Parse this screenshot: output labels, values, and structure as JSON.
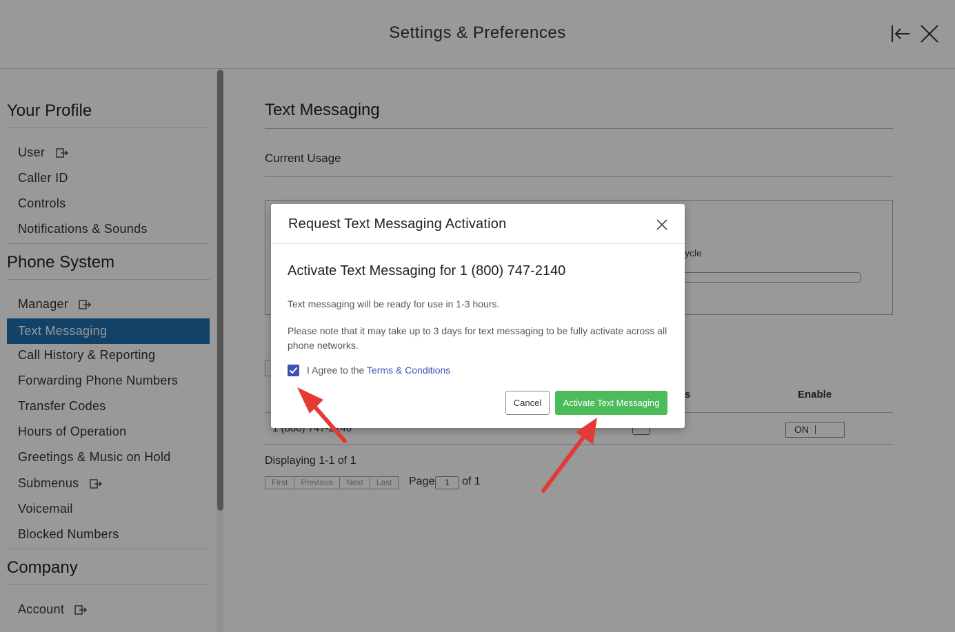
{
  "header": {
    "title": "Settings & Preferences"
  },
  "sidebar": {
    "sections": [
      {
        "title": "Your Profile"
      },
      {
        "title": "Phone System"
      },
      {
        "title": "Company"
      }
    ],
    "profile_items": [
      "User",
      "Caller ID",
      "Controls",
      "Notifications & Sounds"
    ],
    "phone_items": [
      "Manager",
      "Text Messaging",
      "Call History & Reporting",
      "Forwarding Phone Numbers",
      "Transfer Codes",
      "Hours of Operation",
      "Greetings & Music on Hold",
      "Submenus",
      "Voicemail",
      "Blocked Numbers"
    ],
    "company_items": [
      "Account"
    ],
    "active_item": "Text Messaging"
  },
  "main": {
    "title": "Text Messaging",
    "usage_label": "Current Usage",
    "cycle_partial": "ycle",
    "col_partial": "s",
    "col_enable": "Enable",
    "row_number": "1 (800) 747-2140",
    "toggle_label": "ON",
    "displaying": "Displaying 1-1 of 1",
    "pager": {
      "first": "First",
      "previous": "Previous",
      "next": "Next",
      "last": "Last"
    },
    "page_label": "Page",
    "page_value": "1",
    "page_of": "of 1"
  },
  "modal": {
    "title": "Request Text Messaging Activation",
    "subtitle": "Activate Text Messaging for 1 (800) 747-2140",
    "p1": "Text messaging will be ready for use in 1-3 hours.",
    "p2": "Please note that it may take up to 3 days for text messaging to be fully activate across all phone networks.",
    "agree_prefix": "I Agree to the ",
    "terms_link": "Terms & Conditions",
    "checkbox_checked": true,
    "cancel": "Cancel",
    "activate": "Activate Text Messaging"
  },
  "colors": {
    "active_nav": "#1e6fae",
    "activate_button": "#4cbb5a",
    "checkbox": "#3f51b5",
    "annotation_arrow": "#e53935"
  },
  "icons": [
    "collapse-panel-icon",
    "close-icon",
    "external-link-icon",
    "checkmark-icon",
    "annotation-arrow"
  ]
}
